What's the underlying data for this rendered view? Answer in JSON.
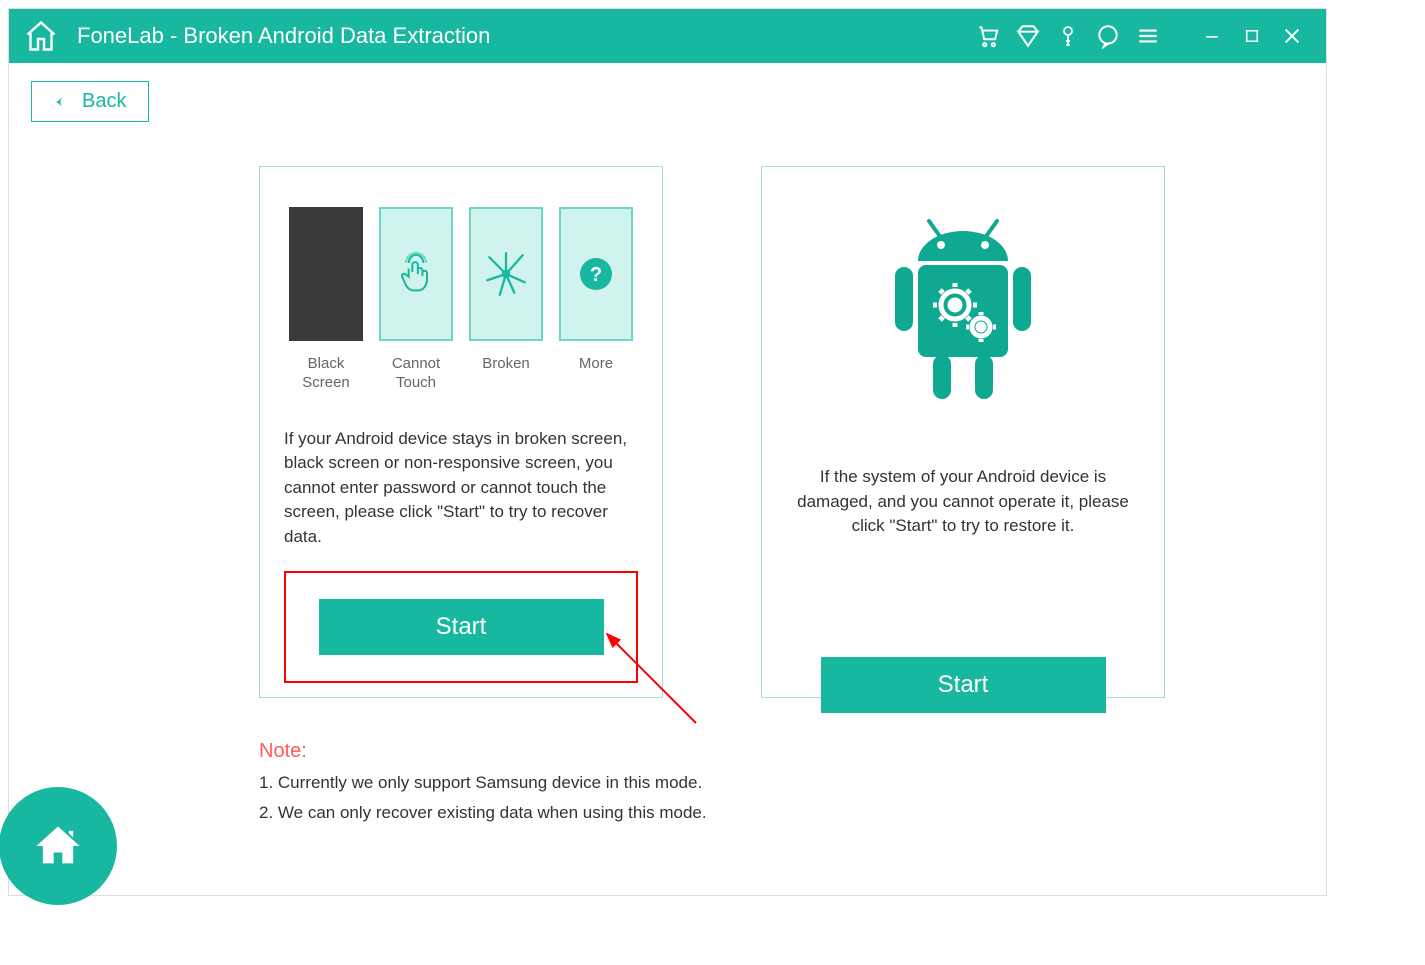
{
  "titlebar": {
    "title": "FoneLab - Broken Android Data Extraction"
  },
  "back": {
    "label": "Back"
  },
  "panel1": {
    "icons": [
      {
        "label": "Black Screen"
      },
      {
        "label": "Cannot Touch"
      },
      {
        "label": "Broken"
      },
      {
        "label": "More"
      }
    ],
    "text": "If your Android device stays in broken screen, black screen or non-responsive screen, you cannot enter password or cannot touch the screen, please click \"Start\" to try to recover data.",
    "start": "Start"
  },
  "panel2": {
    "text": "If the system of your Android device is damaged, and you cannot operate it, please click \"Start\" to try to restore it.",
    "start": "Start"
  },
  "note": {
    "heading": "Note:",
    "line1": "1. Currently we only support Samsung device in this mode.",
    "line2": "2. We can only recover existing data when using this mode."
  }
}
